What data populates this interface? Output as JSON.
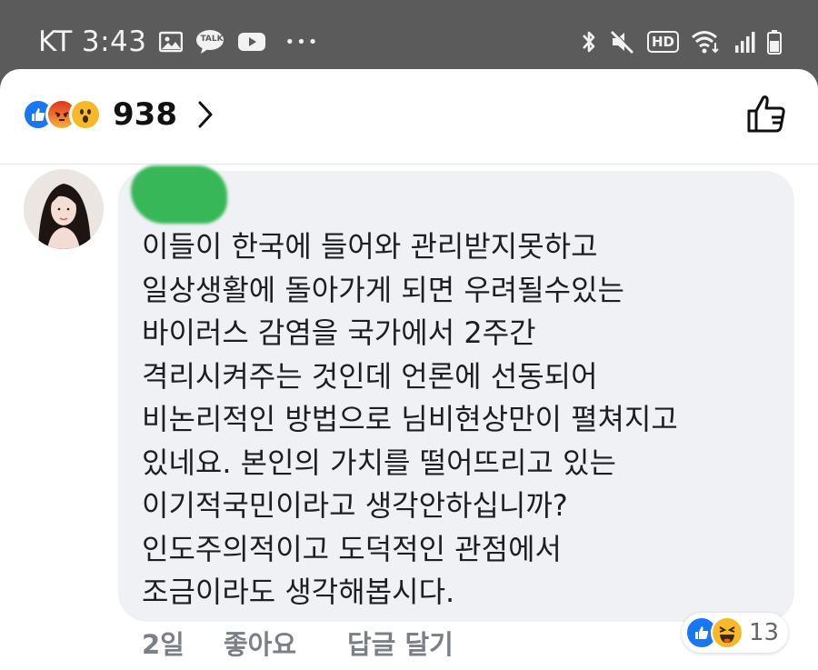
{
  "status_bar": {
    "carrier": "KT",
    "time": "3:43",
    "left_icons": [
      "gallery-icon",
      "kakaotalk-icon",
      "youtube-icon",
      "more-icon"
    ],
    "kakaotalk_label": "TALK",
    "right_icons": [
      "bluetooth-icon",
      "mute-icon",
      "hd-icon",
      "wifi-icon",
      "signal-icon",
      "battery-icon"
    ],
    "hd_label": "HD",
    "more_label": "•••"
  },
  "header": {
    "reactions": [
      "like",
      "angry",
      "wow"
    ],
    "reaction_count": "938",
    "colors": {
      "like_blue": "#1877f2",
      "angry_orange": "#f0582a",
      "wow_yellow": "#f7b928"
    }
  },
  "comment": {
    "author_redacted": true,
    "lines": [
      "이들이 한국에 들어와 관리받지못하고",
      "일상생활에 돌아가게 되면 우려될수있는",
      "바이러스 감염을 국가에서 2주간",
      "격리시켜주는 것인데 언론에 선동되어",
      "비논리적인 방법으로 님비현상만이 펼쳐지고",
      "있네요. 본인의 가치를 떨어뜨리고 있는",
      "이기적국민이라고 생각안하십니까?",
      "인도주의적이고 도덕적인 관점에서",
      "조금이라도 생각해봅시다."
    ],
    "time_ago": "2일",
    "like_label": "좋아요",
    "reply_label": "답글 달기",
    "reactions": [
      "like",
      "haha"
    ],
    "reaction_count": "13",
    "redaction_color": "#2fb451"
  }
}
